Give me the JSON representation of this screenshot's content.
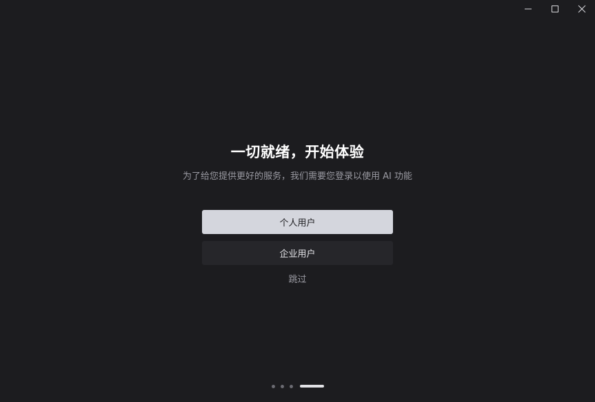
{
  "window_controls": {
    "minimize": "minimize-icon",
    "maximize": "maximize-icon",
    "close": "close-icon"
  },
  "onboarding": {
    "title": "一切就绪，开始体验",
    "subtitle": "为了给您提供更好的服务，我们需要您登录以使用 AI 功能",
    "personal_button": "个人用户",
    "enterprise_button": "企业用户",
    "skip_link": "跳过"
  },
  "pager": {
    "total_steps": 4,
    "current_step": 4
  },
  "colors": {
    "background": "#1c1c1f",
    "primary_button": "#d4d6dd",
    "secondary_button": "#26262a",
    "muted_text": "#9a9aa2"
  }
}
